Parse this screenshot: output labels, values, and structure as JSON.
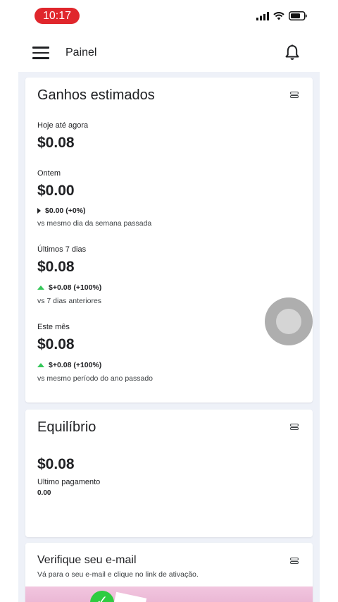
{
  "status_bar": {
    "time": "10:17"
  },
  "app_bar": {
    "title": "Painel"
  },
  "earnings_card": {
    "title": "Ganhos estimados",
    "today": {
      "label": "Hoje até agora",
      "amount": "$0.08"
    },
    "yesterday": {
      "label": "Ontem",
      "amount": "$0.00",
      "delta": "$0.00 (+0%)",
      "comparison": "vs mesmo dia da semana passada"
    },
    "last7": {
      "label": "Últimos 7 dias",
      "amount": "$0.08",
      "delta": "$+0.08 (+100%)",
      "comparison": "vs 7 dias anteriores"
    },
    "this_month": {
      "label": "Este mês",
      "amount": "$0.08",
      "delta": "$+0.08 (+100%)",
      "comparison": "vs mesmo período do ano passado"
    },
    "colors": {
      "positive": "#34c759",
      "neutral": "#202124"
    }
  },
  "balance_card": {
    "title": "Equilíbrio",
    "amount": "$0.08",
    "last_payment_label": "Ultimo pagamento",
    "last_payment_value": "0.00"
  },
  "verify_card": {
    "title": "Verifique seu e-mail",
    "subtitle": "Vá para o seu e-mail e clique no link de ativação."
  },
  "icons": {
    "menu": "hamburger-icon",
    "notifications": "bell-icon",
    "card_menu": "card-menu-icon"
  }
}
